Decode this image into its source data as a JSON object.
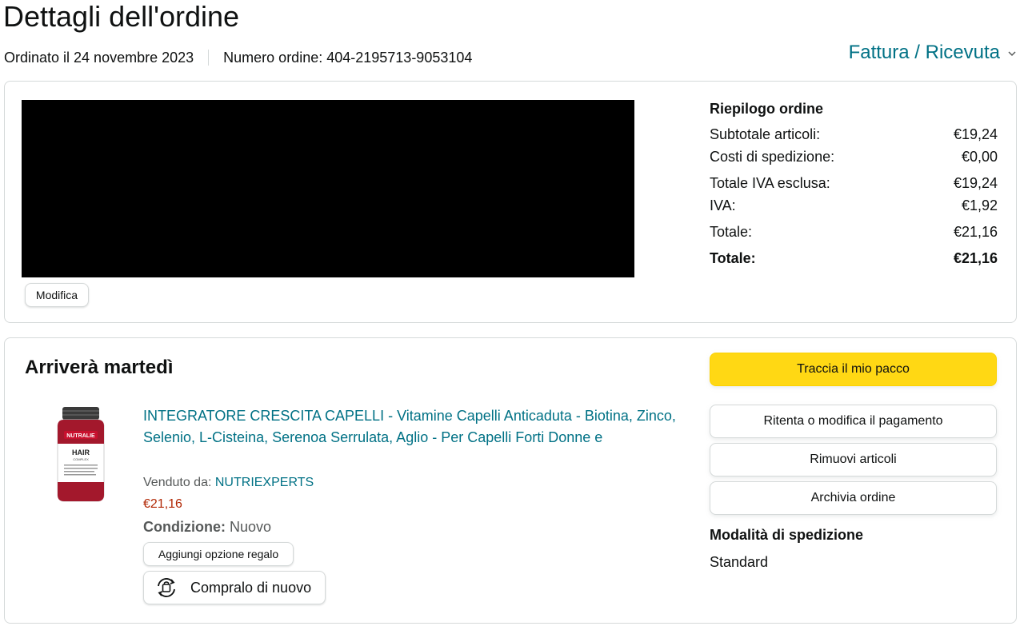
{
  "header": {
    "title": "Dettagli dell'ordine",
    "ordered_on": "Ordinato il 24 novembre 2023",
    "order_number": "Numero ordine: 404-2195713-9053104",
    "invoice_link": "Fattura / Ricevuta"
  },
  "address_box": {
    "edit_label": "Modifica"
  },
  "summary": {
    "title": "Riepilogo ordine",
    "rows": [
      {
        "label": "Subtotale articoli:",
        "value": "€19,24"
      },
      {
        "label": "Costi di spedizione:",
        "value": "€0,00"
      },
      {
        "label": "Totale IVA esclusa:",
        "value": "€19,24"
      },
      {
        "label": "IVA:",
        "value": "€1,92"
      },
      {
        "label": "Totale:",
        "value": "€21,16"
      },
      {
        "label": "Totale:",
        "value": "€21,16"
      }
    ]
  },
  "shipment": {
    "arrival": "Arriverà martedì",
    "product": {
      "title": "INTEGRATORE CRESCITA CAPELLI - Vitamine Capelli Anticaduta - Biotina, Zinco, Selenio, L-Cisteina, Serenoa Serrulata, Aglio - Per Capelli Forti Donne e",
      "sold_by_label": "Venduto da:",
      "seller": "NUTRIEXPERTS",
      "price": "€21,16",
      "condition_label": "Condizione:",
      "condition_value": "Nuovo",
      "bottle_brand": "NUTRALIE",
      "bottle_name": "HAIR",
      "bottle_sub": "COMPLEX"
    },
    "gift_button": "Aggiungi opzione regalo",
    "buy_again_button": "Compralo di nuovo",
    "actions": {
      "track": "Traccia il mio pacco",
      "retry_payment": "Ritenta o modifica il pagamento",
      "remove_items": "Rimuovi articoli",
      "archive": "Archivia ordine"
    },
    "shipping_method_label": "Modalità di spedizione",
    "shipping_method_value": "Standard"
  },
  "colors": {
    "link": "#007185",
    "price": "#b12704",
    "primary_button": "#ffd814",
    "border": "#d5d9d9"
  }
}
